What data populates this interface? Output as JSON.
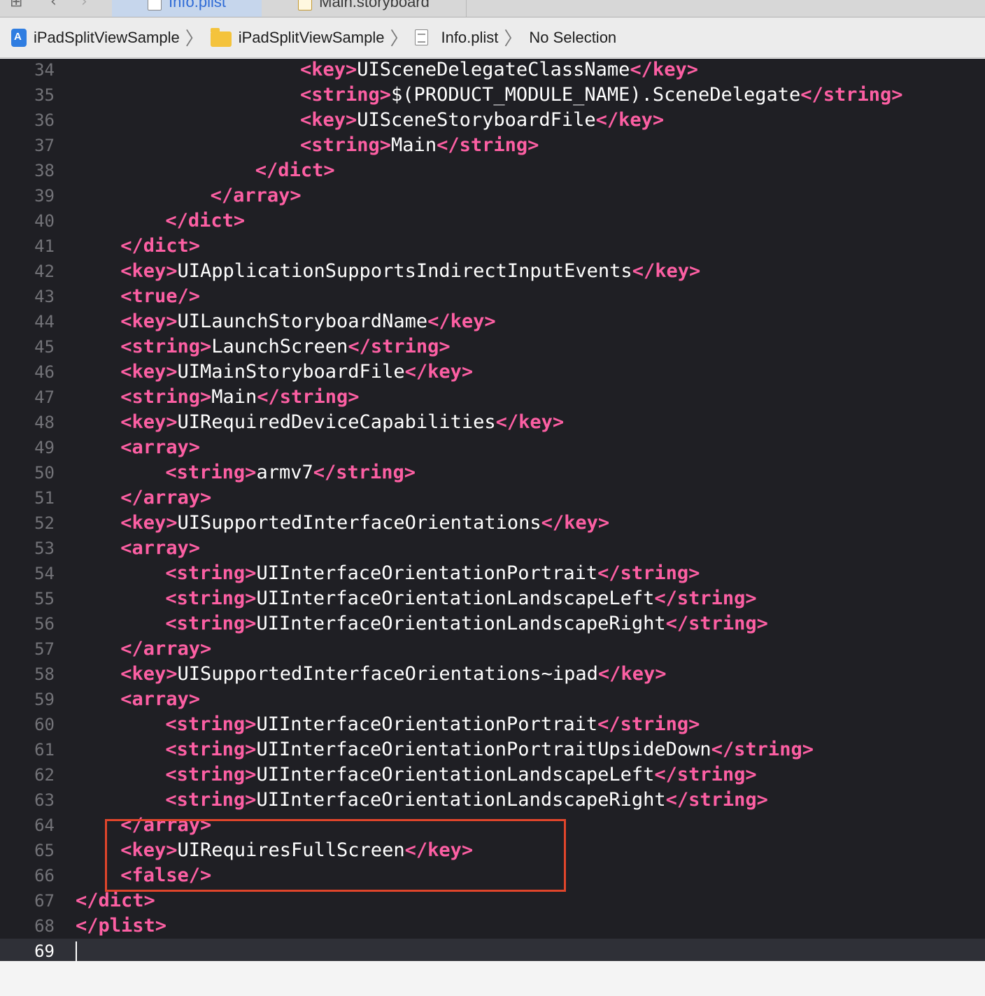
{
  "tabs": [
    {
      "label": "Info.plist",
      "active": true
    },
    {
      "label": "Main.storyboard",
      "active": false
    }
  ],
  "breadcrumbs": [
    {
      "label": "iPadSplitViewSample",
      "icon": "xcode-project-icon"
    },
    {
      "label": "iPadSplitViewSample",
      "icon": "folder-icon"
    },
    {
      "label": "Info.plist",
      "icon": "plist-file-icon"
    },
    {
      "label": "No Selection",
      "icon": ""
    }
  ],
  "colors": {
    "tag": "#fc5fa3",
    "text": "#ffffff",
    "background": "#1f1f24",
    "highlight_box": "#e0452b"
  },
  "lines": [
    {
      "n": "34",
      "indent": 10,
      "parts": [
        {
          "t": "<key>",
          "k": "tag"
        },
        {
          "t": "UISceneDelegateClassName",
          "k": "txt"
        },
        {
          "t": "</key>",
          "k": "tag"
        }
      ]
    },
    {
      "n": "35",
      "indent": 10,
      "parts": [
        {
          "t": "<string>",
          "k": "tag"
        },
        {
          "t": "$(PRODUCT_MODULE_NAME).SceneDelegate",
          "k": "txt"
        },
        {
          "t": "</string>",
          "k": "tag"
        }
      ]
    },
    {
      "n": "36",
      "indent": 10,
      "parts": [
        {
          "t": "<key>",
          "k": "tag"
        },
        {
          "t": "UISceneStoryboardFile",
          "k": "txt"
        },
        {
          "t": "</key>",
          "k": "tag"
        }
      ]
    },
    {
      "n": "37",
      "indent": 10,
      "parts": [
        {
          "t": "<string>",
          "k": "tag"
        },
        {
          "t": "Main",
          "k": "txt"
        },
        {
          "t": "</string>",
          "k": "tag"
        }
      ]
    },
    {
      "n": "38",
      "indent": 8,
      "parts": [
        {
          "t": "</dict>",
          "k": "tag"
        }
      ]
    },
    {
      "n": "39",
      "indent": 6,
      "parts": [
        {
          "t": "</array>",
          "k": "tag"
        }
      ]
    },
    {
      "n": "40",
      "indent": 4,
      "parts": [
        {
          "t": "</dict>",
          "k": "tag"
        }
      ]
    },
    {
      "n": "41",
      "indent": 2,
      "parts": [
        {
          "t": "</dict>",
          "k": "tag"
        }
      ]
    },
    {
      "n": "42",
      "indent": 2,
      "parts": [
        {
          "t": "<key>",
          "k": "tag"
        },
        {
          "t": "UIApplicationSupportsIndirectInputEvents",
          "k": "txt"
        },
        {
          "t": "</key>",
          "k": "tag"
        }
      ]
    },
    {
      "n": "43",
      "indent": 2,
      "parts": [
        {
          "t": "<true/>",
          "k": "tag"
        }
      ]
    },
    {
      "n": "44",
      "indent": 2,
      "parts": [
        {
          "t": "<key>",
          "k": "tag"
        },
        {
          "t": "UILaunchStoryboardName",
          "k": "txt"
        },
        {
          "t": "</key>",
          "k": "tag"
        }
      ]
    },
    {
      "n": "45",
      "indent": 2,
      "parts": [
        {
          "t": "<string>",
          "k": "tag"
        },
        {
          "t": "LaunchScreen",
          "k": "txt"
        },
        {
          "t": "</string>",
          "k": "tag"
        }
      ]
    },
    {
      "n": "46",
      "indent": 2,
      "parts": [
        {
          "t": "<key>",
          "k": "tag"
        },
        {
          "t": "UIMainStoryboardFile",
          "k": "txt"
        },
        {
          "t": "</key>",
          "k": "tag"
        }
      ]
    },
    {
      "n": "47",
      "indent": 2,
      "parts": [
        {
          "t": "<string>",
          "k": "tag"
        },
        {
          "t": "Main",
          "k": "txt"
        },
        {
          "t": "</string>",
          "k": "tag"
        }
      ]
    },
    {
      "n": "48",
      "indent": 2,
      "parts": [
        {
          "t": "<key>",
          "k": "tag"
        },
        {
          "t": "UIRequiredDeviceCapabilities",
          "k": "txt"
        },
        {
          "t": "</key>",
          "k": "tag"
        }
      ]
    },
    {
      "n": "49",
      "indent": 2,
      "parts": [
        {
          "t": "<array>",
          "k": "tag"
        }
      ]
    },
    {
      "n": "50",
      "indent": 4,
      "parts": [
        {
          "t": "<string>",
          "k": "tag"
        },
        {
          "t": "armv7",
          "k": "txt"
        },
        {
          "t": "</string>",
          "k": "tag"
        }
      ]
    },
    {
      "n": "51",
      "indent": 2,
      "parts": [
        {
          "t": "</array>",
          "k": "tag"
        }
      ]
    },
    {
      "n": "52",
      "indent": 2,
      "parts": [
        {
          "t": "<key>",
          "k": "tag"
        },
        {
          "t": "UISupportedInterfaceOrientations",
          "k": "txt"
        },
        {
          "t": "</key>",
          "k": "tag"
        }
      ]
    },
    {
      "n": "53",
      "indent": 2,
      "parts": [
        {
          "t": "<array>",
          "k": "tag"
        }
      ]
    },
    {
      "n": "54",
      "indent": 4,
      "parts": [
        {
          "t": "<string>",
          "k": "tag"
        },
        {
          "t": "UIInterfaceOrientationPortrait",
          "k": "txt"
        },
        {
          "t": "</string>",
          "k": "tag"
        }
      ]
    },
    {
      "n": "55",
      "indent": 4,
      "parts": [
        {
          "t": "<string>",
          "k": "tag"
        },
        {
          "t": "UIInterfaceOrientationLandscapeLeft",
          "k": "txt"
        },
        {
          "t": "</string>",
          "k": "tag"
        }
      ]
    },
    {
      "n": "56",
      "indent": 4,
      "parts": [
        {
          "t": "<string>",
          "k": "tag"
        },
        {
          "t": "UIInterfaceOrientationLandscapeRight",
          "k": "txt"
        },
        {
          "t": "</string>",
          "k": "tag"
        }
      ]
    },
    {
      "n": "57",
      "indent": 2,
      "parts": [
        {
          "t": "</array>",
          "k": "tag"
        }
      ]
    },
    {
      "n": "58",
      "indent": 2,
      "parts": [
        {
          "t": "<key>",
          "k": "tag"
        },
        {
          "t": "UISupportedInterfaceOrientations~ipad",
          "k": "txt"
        },
        {
          "t": "</key>",
          "k": "tag"
        }
      ]
    },
    {
      "n": "59",
      "indent": 2,
      "parts": [
        {
          "t": "<array>",
          "k": "tag"
        }
      ]
    },
    {
      "n": "60",
      "indent": 4,
      "parts": [
        {
          "t": "<string>",
          "k": "tag"
        },
        {
          "t": "UIInterfaceOrientationPortrait",
          "k": "txt"
        },
        {
          "t": "</string>",
          "k": "tag"
        }
      ]
    },
    {
      "n": "61",
      "indent": 4,
      "parts": [
        {
          "t": "<string>",
          "k": "tag"
        },
        {
          "t": "UIInterfaceOrientationPortraitUpsideDown",
          "k": "txt"
        },
        {
          "t": "</string>",
          "k": "tag"
        }
      ]
    },
    {
      "n": "62",
      "indent": 4,
      "parts": [
        {
          "t": "<string>",
          "k": "tag"
        },
        {
          "t": "UIInterfaceOrientationLandscapeLeft",
          "k": "txt"
        },
        {
          "t": "</string>",
          "k": "tag"
        }
      ]
    },
    {
      "n": "63",
      "indent": 4,
      "parts": [
        {
          "t": "<string>",
          "k": "tag"
        },
        {
          "t": "UIInterfaceOrientationLandscapeRight",
          "k": "txt"
        },
        {
          "t": "</string>",
          "k": "tag"
        }
      ]
    },
    {
      "n": "64",
      "indent": 2,
      "parts": [
        {
          "t": "</array>",
          "k": "tag"
        }
      ]
    },
    {
      "n": "65",
      "indent": 2,
      "parts": [
        {
          "t": "<key>",
          "k": "tag"
        },
        {
          "t": "UIRequiresFullScreen",
          "k": "txt"
        },
        {
          "t": "</key>",
          "k": "tag"
        }
      ]
    },
    {
      "n": "66",
      "indent": 2,
      "parts": [
        {
          "t": "<false/>",
          "k": "tag"
        }
      ]
    },
    {
      "n": "67",
      "indent": 0,
      "parts": [
        {
          "t": "</dict>",
          "k": "tag"
        }
      ]
    },
    {
      "n": "68",
      "indent": 0,
      "parts": [
        {
          "t": "</plist>",
          "k": "tag"
        }
      ]
    },
    {
      "n": "69",
      "indent": 0,
      "parts": [],
      "current": true
    }
  ]
}
